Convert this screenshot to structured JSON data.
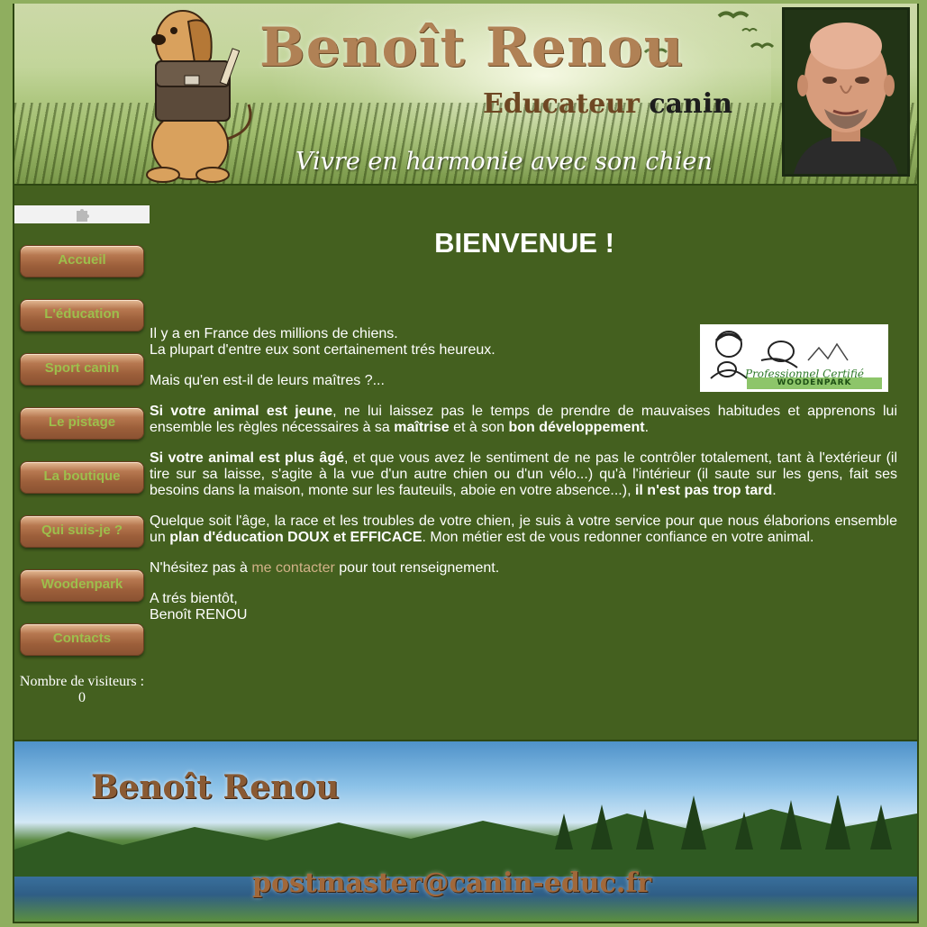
{
  "header": {
    "title": "Benoît Renou",
    "subtitle_word1": "Educateur",
    "subtitle_word2": "canin",
    "tagline": "Vivre en harmonie avec son chien"
  },
  "nav": {
    "items": [
      {
        "label": "Accueil"
      },
      {
        "label": "L'éducation"
      },
      {
        "label": "Sport canin"
      },
      {
        "label": "Le pistage"
      },
      {
        "label": "La boutique"
      },
      {
        "label": "Qui suis-je ?"
      },
      {
        "label": "Woodenpark"
      },
      {
        "label": "Contacts"
      }
    ],
    "visitors_label": "Nombre de visiteurs :",
    "visitors_count": "0"
  },
  "main": {
    "heading": "BIENVENUE !",
    "badge": {
      "line1": "Professionnel Certifié",
      "line2": "WOODENPARK"
    },
    "p1_l1": "Il y a en France des millions de chiens.",
    "p1_l2": "La plupart d'entre eux sont certainement trés heureux.",
    "p2": "Mais qu'en est-il de leurs maîtres ?...",
    "p3_b1": "Si votre animal est jeune",
    "p3_t1": ", ne lui laissez pas le temps de prendre de mauvaises habitudes et apprenons lui ensemble les règles nécessaires à sa ",
    "p3_b2": "maîtrise",
    "p3_t2": " et à son ",
    "p3_b3": "bon développement",
    "p3_t3": ".",
    "p4_b1": "Si votre animal est plus âgé",
    "p4_t1": ", et que vous avez le sentiment de ne pas le contrôler totalement, tant à l'extérieur (il tire sur sa laisse, s'agite à la vue d'un autre chien ou d'un vélo...) qu'à l'intérieur (il saute sur les gens, fait ses besoins dans la maison, monte sur les fauteuils, aboie en votre absence...), ",
    "p4_b2": "il n'est pas trop tard",
    "p4_t2": ".",
    "p5_t1": "Quelque soit l'âge, la race et les troubles de votre chien, je suis à votre service pour que nous élaborions ensemble un ",
    "p5_b1": "plan d'éducation DOUX et EFFICACE",
    "p5_t2": ". Mon métier est de vous redonner confiance en votre animal.",
    "p6_t1": "N'hésitez pas à ",
    "p6_link": "me contacter",
    "p6_t2": " pour tout renseignement.",
    "p7_l1": "A trés bientôt,",
    "p7_l2": "Benoît RENOU"
  },
  "footer": {
    "title": "Benoît Renou",
    "email": "postmaster@canin-educ.fr"
  },
  "colors": {
    "page_bg": "#8fae5f",
    "content_bg": "#44601f",
    "nav_text": "#9dbf4c",
    "link": "#d2b288",
    "title_brown": "#b08155"
  }
}
